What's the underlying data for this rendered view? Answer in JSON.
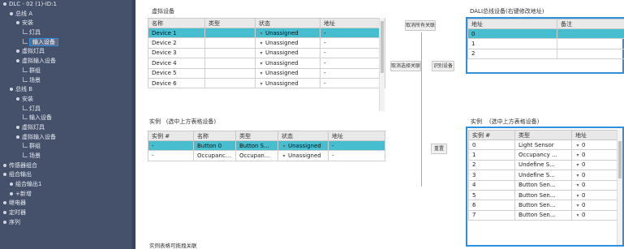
{
  "sidebar": {
    "items": [
      {
        "label": "DLC - 02 (1)-ID:1",
        "level": 0
      },
      {
        "label": "总线 A",
        "level": 1
      },
      {
        "label": "安装",
        "level": 2
      },
      {
        "label": "灯具",
        "level": 3
      },
      {
        "label": "输入设备",
        "level": 3,
        "selected": true
      },
      {
        "label": "虚拟灯具",
        "level": 2
      },
      {
        "label": "虚拟输入设备",
        "level": 2
      },
      {
        "label": "群组",
        "level": 3
      },
      {
        "label": "场景",
        "level": 3
      },
      {
        "label": "总线 B",
        "level": 1
      },
      {
        "label": "安装",
        "level": 2
      },
      {
        "label": "灯具",
        "level": 3
      },
      {
        "label": "输入设备",
        "level": 3
      },
      {
        "label": "虚拟灯具",
        "level": 2
      },
      {
        "label": "虚拟输入设备",
        "level": 2
      },
      {
        "label": "群组",
        "level": 3
      },
      {
        "label": "场景",
        "level": 3
      },
      {
        "label": "传感器组合",
        "level": 0
      },
      {
        "label": "组合输出",
        "level": 0
      },
      {
        "label": "组合输出1",
        "level": 1
      },
      {
        "label": "+新增",
        "level": 1
      },
      {
        "label": "继电器",
        "level": 0
      },
      {
        "label": "定时器",
        "level": 0
      },
      {
        "label": "序列",
        "level": 0
      }
    ]
  },
  "virtual": {
    "title": "虚拟设备",
    "columns": [
      "名称",
      "类型",
      "状态",
      "地址"
    ],
    "rows": [
      {
        "name": "Device 1",
        "type": "",
        "status": "Unassigned",
        "address": "-",
        "selected": true
      },
      {
        "name": "Device 2",
        "type": "",
        "status": "Unassigned",
        "address": "-"
      },
      {
        "name": "Device 3",
        "type": "",
        "status": "Unassigned",
        "address": "-"
      },
      {
        "name": "Device 4",
        "type": "",
        "status": "Unassigned",
        "address": "-"
      },
      {
        "name": "Device 5",
        "type": "",
        "status": "Unassigned",
        "address": "-"
      },
      {
        "name": "Device 6",
        "type": "",
        "status": "Unassigned",
        "address": "-"
      }
    ]
  },
  "instance": {
    "title": "实例",
    "hint": "(选中上方表格设备)",
    "columns": [
      "实例 #",
      "名称",
      "类型",
      "状态",
      "地址"
    ],
    "rows": [
      {
        "inst": "-",
        "name": "Button 0",
        "type": "Button S...",
        "status": "Unassigned",
        "address": "-",
        "selected": true
      },
      {
        "inst": "-",
        "name": "Occupancy ...",
        "type": "Occupan...",
        "status": "Unassigned",
        "address": "-"
      }
    ],
    "footer": "实例表格可拖拽关联"
  },
  "buttons": {
    "unlink_all": "取消所有关联",
    "unlink_selected": "取消选择关联",
    "identify": "识别设备",
    "reset": "重置"
  },
  "dali": {
    "title": "DALI总线设备(右键修改地址)",
    "columns": [
      "地址",
      "备注"
    ],
    "rows": [
      {
        "address": "0",
        "note": "",
        "selected": true
      },
      {
        "address": "1",
        "note": ""
      },
      {
        "address": "2",
        "note": ""
      }
    ]
  },
  "dali_instance": {
    "title": "实例",
    "hint": "(选中上方表格设备)",
    "columns": [
      "实例 #",
      "类型",
      "地址"
    ],
    "rows": [
      {
        "inst": "0",
        "type": "Light Sensor",
        "address": "0"
      },
      {
        "inst": "1",
        "type": "Occupancy ...",
        "address": "0"
      },
      {
        "inst": "2",
        "type": "Undefine S...",
        "address": "0"
      },
      {
        "inst": "3",
        "type": "Undefine S...",
        "address": "0"
      },
      {
        "inst": "4",
        "type": "Button Sen...",
        "address": "0"
      },
      {
        "inst": "5",
        "type": "Button Sen...",
        "address": "0"
      },
      {
        "inst": "6",
        "type": "Button Sen...",
        "address": "0"
      },
      {
        "inst": "7",
        "type": "Button Sen...",
        "address": "0"
      }
    ]
  },
  "colors": {
    "sidebar": "#45506a",
    "selection": "#47bdd0",
    "accent": "#2d8fe0"
  }
}
